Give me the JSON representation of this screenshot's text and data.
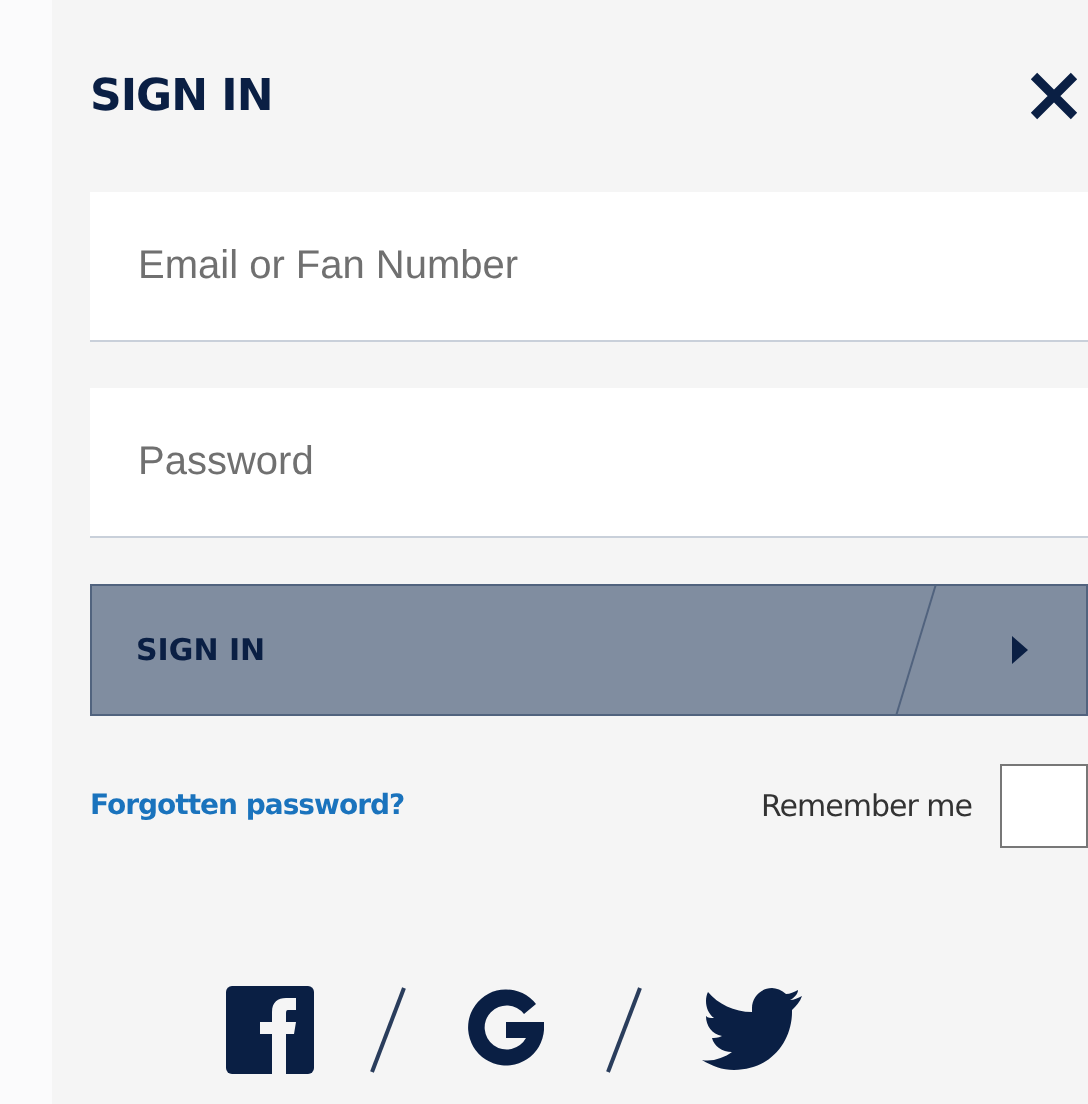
{
  "title": "SIGN IN",
  "fields": [
    {
      "placeholder": "Email or Fan Number"
    },
    {
      "placeholder": "Password"
    }
  ],
  "submit": {
    "label": "SIGN IN"
  },
  "forgot_link": "Forgotten password?",
  "remember": {
    "label": "Remember me",
    "checked": false
  },
  "social": [
    {
      "kind": "facebook"
    },
    {
      "kind": "google"
    },
    {
      "kind": "twitter"
    }
  ]
}
